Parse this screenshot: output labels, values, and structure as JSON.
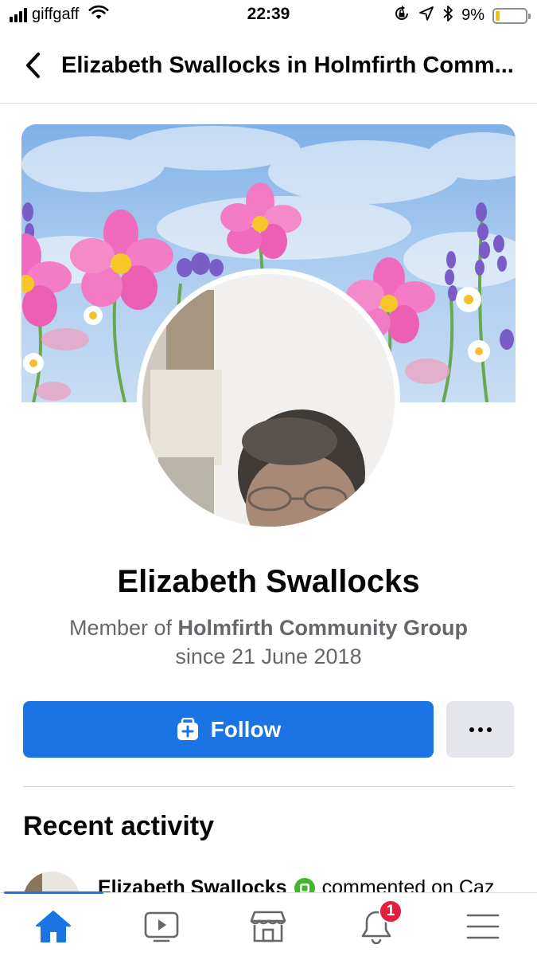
{
  "status_bar": {
    "carrier": "giffgaff",
    "time": "22:39",
    "battery_percent": "9%",
    "battery_level": 0.09,
    "battery_color": "#f5c400",
    "icons": [
      "signal-icon",
      "wifi-icon",
      "orientation-lock-icon",
      "location-arrow-icon",
      "bluetooth-icon",
      "battery-icon"
    ]
  },
  "header": {
    "title": "Elizabeth Swallocks in Holmfirth Comm...",
    "back_icon": "chevron-left-icon"
  },
  "profile": {
    "name": "Elizabeth Swallocks",
    "membership_prefix": "Member of ",
    "group_name": "Holmfirth Community Group",
    "since": "since 21 June 2018"
  },
  "actions": {
    "follow_label": "Follow",
    "follow_icon": "follow-add-icon",
    "more_icon": "more-dots-icon"
  },
  "recent_activity": {
    "title": "Recent activity",
    "items": [
      {
        "actor": "Elizabeth Swallocks",
        "badge_icon": "member-badge-icon",
        "text": "commented on Caz"
      }
    ]
  },
  "tab_bar": {
    "tabs": [
      {
        "name": "home",
        "icon": "home-icon",
        "active": true
      },
      {
        "name": "watch",
        "icon": "video-icon",
        "active": false
      },
      {
        "name": "marketplace",
        "icon": "marketplace-icon",
        "active": false
      },
      {
        "name": "notifications",
        "icon": "bell-icon",
        "active": false,
        "badge": "1"
      },
      {
        "name": "menu",
        "icon": "hamburger-menu-icon",
        "active": false
      }
    ]
  },
  "colors": {
    "brand_blue": "#1b74e4",
    "secondary_text": "#65676b",
    "notification_red": "#e41e3f",
    "badge_green": "#42b72a"
  }
}
